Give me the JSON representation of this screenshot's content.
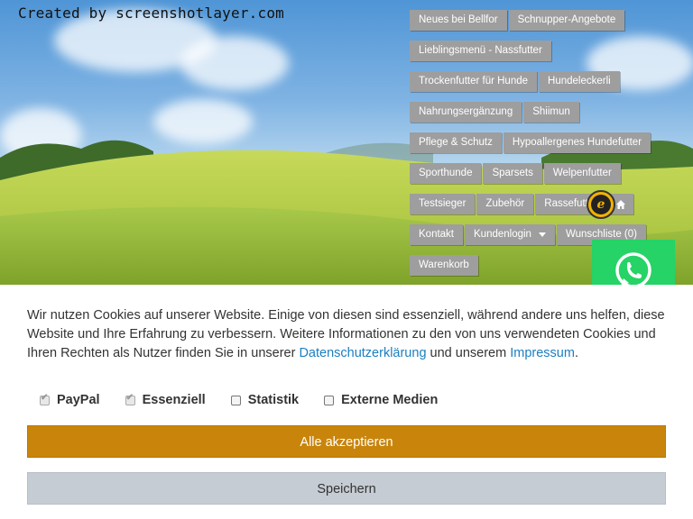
{
  "watermark": "Created by screenshotlayer.com",
  "menu": {
    "rows": [
      [
        "Neues bei Bellfor",
        "Schnupper-Angebote"
      ],
      [
        "Lieblingsmenü - Nassfutter"
      ],
      [
        "Trockenfutter für Hunde",
        "Hundeleckerli"
      ],
      [
        "Nahrungsergänzung",
        "Shiimun"
      ],
      [
        "Pflege & Schutz",
        "Hypoallergenes Hundefutter"
      ],
      [
        "Sporthunde",
        "Sparsets",
        "Welpenfutter"
      ],
      [
        "Testsieger",
        "Zubehör",
        "Rassefutter"
      ],
      [
        "Kontakt",
        "Kundenlogin",
        "Wunschliste (0)"
      ],
      [
        "Warenkorb"
      ]
    ]
  },
  "badges": {
    "trusted_shops": "trusted-shops-badge",
    "whatsapp": "whatsapp-icon",
    "home": "home-icon"
  },
  "cookie": {
    "text_before": "Wir nutzen Cookies auf unserer Website. Einige von diesen sind essenziell, während andere uns helfen, diese Website und Ihre Erfahrung zu verbessern. Weitere Informationen zu den von uns verwendeten Cookies und Ihren Rechten als Nutzer finden Sie in unserer ",
    "privacy_link": "Datenschutzerklärung",
    "text_middle": " und unserem ",
    "imprint_link": "Impressum",
    "text_after": ".",
    "options": [
      {
        "label": "PayPal",
        "checked": true,
        "disabled": true
      },
      {
        "label": "Essenziell",
        "checked": true,
        "disabled": true
      },
      {
        "label": "Statistik",
        "checked": false,
        "disabled": false
      },
      {
        "label": "Externe Medien",
        "checked": false,
        "disabled": false
      }
    ],
    "accept_label": "Alle akzeptieren",
    "save_label": "Speichern"
  },
  "colors": {
    "accept": "#c9850b",
    "save": "#c6ccd3",
    "menu": "#9e9e9e",
    "whatsapp": "#25d366",
    "link": "#1a7fc1"
  }
}
